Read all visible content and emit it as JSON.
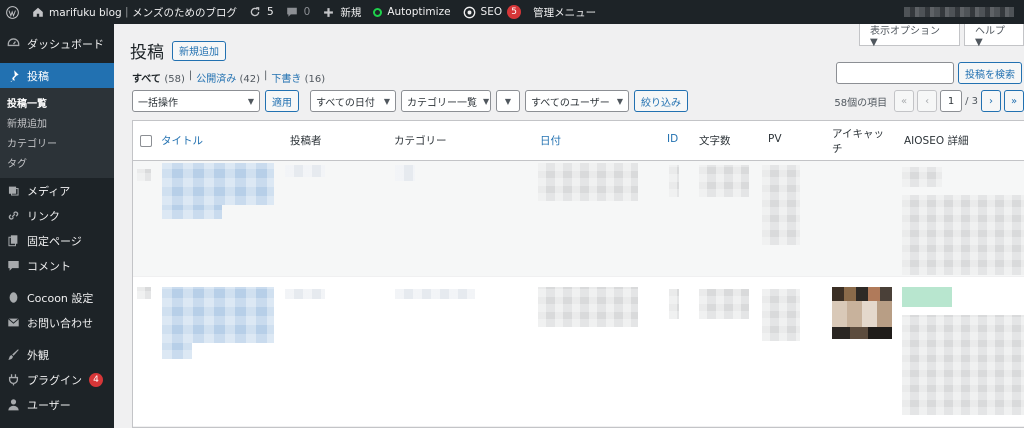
{
  "adminbar": {
    "site_name": "marifuku blog｜メンズのためのブログ",
    "updates_count": "5",
    "comments_count": "0",
    "new_label": "新規",
    "autoptimize_label": "Autoptimize",
    "seo_label": "SEO",
    "seo_badge": "5",
    "admin_menu_label": "管理メニュー"
  },
  "sidebar": {
    "dashboard": "ダッシュボード",
    "posts": "投稿",
    "posts_submenu": [
      "投稿一覧",
      "新規追加",
      "カテゴリー",
      "タグ"
    ],
    "media": "メディア",
    "links": "リンク",
    "pages": "固定ページ",
    "comments": "コメント",
    "cocoon": "Cocoon 設定",
    "contact": "お問い合わせ",
    "appearance": "外観",
    "plugins": "プラグイン",
    "plugins_badge": "4",
    "users": "ユーザー"
  },
  "screen_tabs": {
    "options": "表示オプション ▼",
    "help": "ヘルプ ▼"
  },
  "page": {
    "title": "投稿",
    "add_new": "新規追加"
  },
  "filters": {
    "all": "すべて",
    "all_count": "(58)",
    "published": "公開済み",
    "published_count": "(42)",
    "draft": "下書き",
    "draft_count": "(16)",
    "sep": "|"
  },
  "search": {
    "button": "投稿を検索",
    "value": ""
  },
  "tablenav": {
    "bulk_action": "一括操作",
    "apply": "適用",
    "all_dates": "すべての日付",
    "category_list": "カテゴリー一覧",
    "all_users": "すべてのユーザー",
    "filter": "絞り込み",
    "items_count": "58個の項目",
    "first": "«",
    "prev": "‹",
    "current_page": "1",
    "total_pages": "/ 3",
    "next": "›",
    "last": "»"
  },
  "table": {
    "columns": [
      "タイトル",
      "投稿者",
      "カテゴリー",
      "日付",
      "ID",
      "文字数",
      "PV",
      "アイキャッチ",
      "AIOSEO 詳細"
    ]
  },
  "colors": {
    "admin_bg": "#1d2327",
    "accent": "#2271b1",
    "badge": "#d63638"
  }
}
